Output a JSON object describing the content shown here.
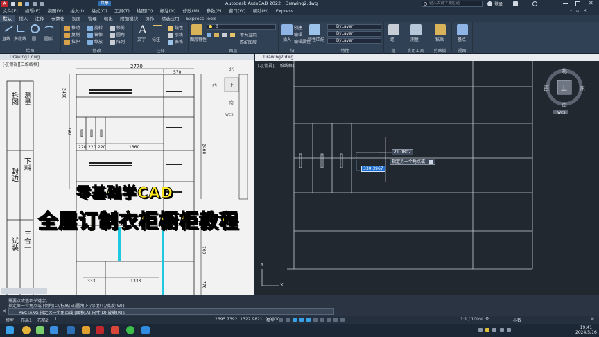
{
  "titlebar": {
    "app_title": "Autodesk AutoCAD 2022",
    "file_name": "Drawing2.dwg",
    "search_placeholder": "键入关键字或短语",
    "login_label": "登录",
    "share_label": "共享"
  },
  "menu": [
    "文件(F)",
    "编辑(E)",
    "视图(V)",
    "插入(I)",
    "格式(O)",
    "工具(T)",
    "绘图(D)",
    "标注(N)",
    "修改(M)",
    "参数(P)",
    "窗口(W)",
    "帮助(H)",
    "Express"
  ],
  "ribbon_tabs": [
    "默认",
    "插入",
    "注释",
    "参数化",
    "视图",
    "管理",
    "输出",
    "附加模块",
    "协作",
    "精选应用",
    "Express Tools"
  ],
  "ribbon_tab_active": 0,
  "ribbon": {
    "draw": {
      "items": [
        "直线",
        "多段线",
        "圆",
        "圆弧"
      ],
      "label": "绘图"
    },
    "modify": {
      "items": [
        "移动",
        "旋转",
        "修剪",
        "复制",
        "镜像",
        "圆角",
        "拉伸",
        "缩放",
        "阵列"
      ],
      "label": "修改"
    },
    "annotation": {
      "items": [
        "文字",
        "标注",
        "线性",
        "引线",
        "表格"
      ],
      "label": "注释"
    },
    "layers": {
      "items": [
        "图层特性",
        "置为当前",
        "匹配图层"
      ],
      "current_layer": "0",
      "label": "图层"
    },
    "block": {
      "items": [
        "插入",
        "创建",
        "编辑",
        "编辑属性"
      ],
      "label": "块"
    },
    "properties": {
      "items": [
        "特性匹配"
      ],
      "bylayer1": "ByLayer",
      "bylayer2": "ByLayer",
      "bylayer3": "ByLayer",
      "label": "特性"
    },
    "groups": {
      "items": [
        "组"
      ],
      "label": "组"
    },
    "utilities": {
      "items": [
        "测量"
      ],
      "label": "实用工具"
    },
    "clipboard": {
      "items": [
        "粘贴"
      ],
      "label": "剪贴板"
    },
    "view": {
      "items": [
        "基点"
      ],
      "label": "视图"
    }
  },
  "left_viewport": {
    "caption": "Drawing1.dwg",
    "subtitle": "[-][俯视][二维线框]",
    "dims": {
      "total": "2770",
      "top_part": "570",
      "h_right": "2460",
      "h_left": "2460",
      "row": "780",
      "w220a": "220",
      "w220b": "220",
      "w220c": "220",
      "w1360": "1360",
      "w333": "333",
      "w1333": "1333",
      "h760": "760",
      "h776": "776"
    },
    "sidebar_labels": [
      "测量",
      "拆图",
      "封边",
      "下料",
      "三合一",
      "试装"
    ],
    "compass": {
      "n": "北",
      "s": "南",
      "w": "西",
      "e": "东",
      "center": "上",
      "wcs": "WCS"
    }
  },
  "overlay": {
    "line1": "零基础学CAD",
    "line2": "全屋订制衣柜橱柜教程"
  },
  "right_viewport": {
    "caption": "Drawing2.dwg",
    "subtitle": "[-][俯视][二维线框]",
    "tooltip_value1": "21.0802",
    "tooltip_prompt": "指定另一个角点或",
    "tooltip_value2": "330.3967",
    "compass": {
      "n": "北",
      "s": "南",
      "w": "西",
      "e": "东",
      "center": "上",
      "wcs": "WCS"
    },
    "ucs_x": "X",
    "ucs_y": "Y"
  },
  "command": {
    "line1": "需要点或选项关键字。",
    "line2": "指定第一个角点或 [倒角(C)/标高(E)/圆角(F)/厚度(T)/宽度(W)]:",
    "prompt": "RECTANG 指定另一个角点或 [面积(A) 尺寸(D) 旋转(R)]:"
  },
  "layout_tabs": [
    "模型",
    "布局1",
    "布局2"
  ],
  "status": {
    "coords": "2695.7392, 1322.9821, 0.0000",
    "model_label": "模型",
    "scale": "1:1 / 100%",
    "units": "小数"
  },
  "taskbar": {
    "time": "19:41",
    "date": "2024/5/16"
  },
  "colors": {
    "accent": "#3aa0e8",
    "overlay_text": "#ffea1f",
    "cyan_panel": "#1ec8e0"
  }
}
